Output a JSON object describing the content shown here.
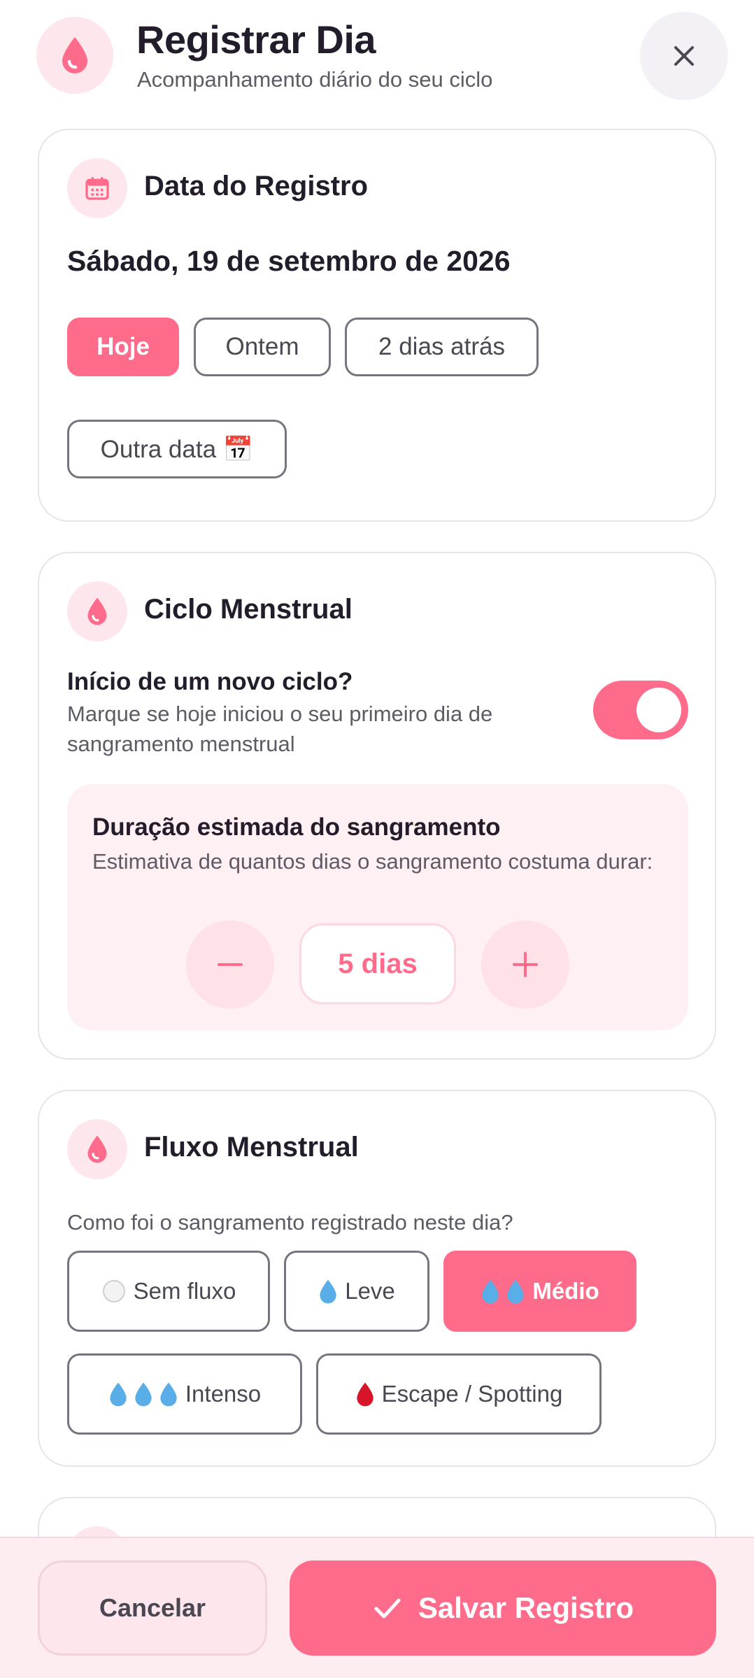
{
  "colors": {
    "accent": "#ff6b8a",
    "accent_soft": "#fde7ec",
    "text": "#231d2b",
    "muted": "#5e5a66"
  },
  "header": {
    "title": "Registrar Dia",
    "subtitle": "Acompanhamento diário do seu ciclo",
    "logo_icon": "drop-icon",
    "close_icon": "close-icon"
  },
  "date_card": {
    "icon": "calendar-icon",
    "title": "Data do Registro",
    "date_label": "Sábado, 19 de setembro de 2026",
    "options": [
      "Hoje",
      "Ontem",
      "2 dias atrás"
    ],
    "selected": "Hoje",
    "other_date": "Outra data 📅"
  },
  "cycle_card": {
    "icon": "drop-icon",
    "title": "Ciclo Menstrual",
    "new_cycle_question": "Início de um novo ciclo?",
    "new_cycle_desc": "Marque se hoje iniciou o seu primeiro dia de sangramento menstrual",
    "new_cycle_on": true,
    "duration_title": "Duração estimada do sangramento",
    "duration_desc": "Estimativa de quantos dias o sangramento costuma durar:",
    "duration_value": "5 dias"
  },
  "flow_card": {
    "icon": "drop-icon",
    "title": "Fluxo Menstrual",
    "question": "Como foi o sangramento registrado neste dia?",
    "options": [
      {
        "label": "Sem fluxo",
        "icon": "empty-circle-icon"
      },
      {
        "label": "Leve",
        "icon": "drop-icon"
      },
      {
        "label": "Médio",
        "icon": "two-drops-icon"
      },
      {
        "label": "Intenso",
        "icon": "three-drops-icon"
      },
      {
        "label": "Escape / Spotting",
        "icon": "red-drop-icon"
      }
    ],
    "selected": "Médio"
  },
  "footer": {
    "cancel_label": "Cancelar",
    "save_label": "Salvar Registro",
    "save_icon": "check-icon"
  }
}
